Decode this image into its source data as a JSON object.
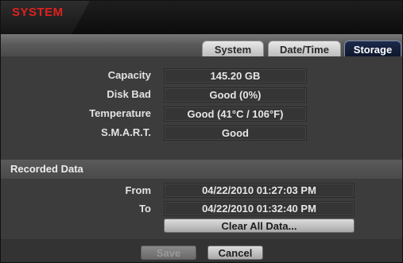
{
  "window": {
    "title": "SYSTEM"
  },
  "tabs": [
    {
      "label": "System",
      "active": false
    },
    {
      "label": "Date/Time",
      "active": false
    },
    {
      "label": "Storage",
      "active": true
    }
  ],
  "storage": {
    "capacity": {
      "label": "Capacity",
      "value": "145.20 GB"
    },
    "disk_bad": {
      "label": "Disk Bad",
      "value": "Good (0%)"
    },
    "temperature": {
      "label": "Temperature",
      "value": "Good (41°C / 106°F)"
    },
    "smart": {
      "label": "S.M.A.R.T.",
      "value": "Good"
    }
  },
  "recorded": {
    "heading": "Recorded Data",
    "from_label": "From",
    "from_value": "04/22/2010  01:27:03 PM",
    "to_label": "To",
    "to_value": "04/22/2010  01:32:40 PM",
    "clear_button": "Clear All Data..."
  },
  "footer": {
    "save_label": "Save",
    "cancel_label": "Cancel"
  },
  "colors": {
    "title_red": "#e02020",
    "active_tab": "#0c1428"
  }
}
